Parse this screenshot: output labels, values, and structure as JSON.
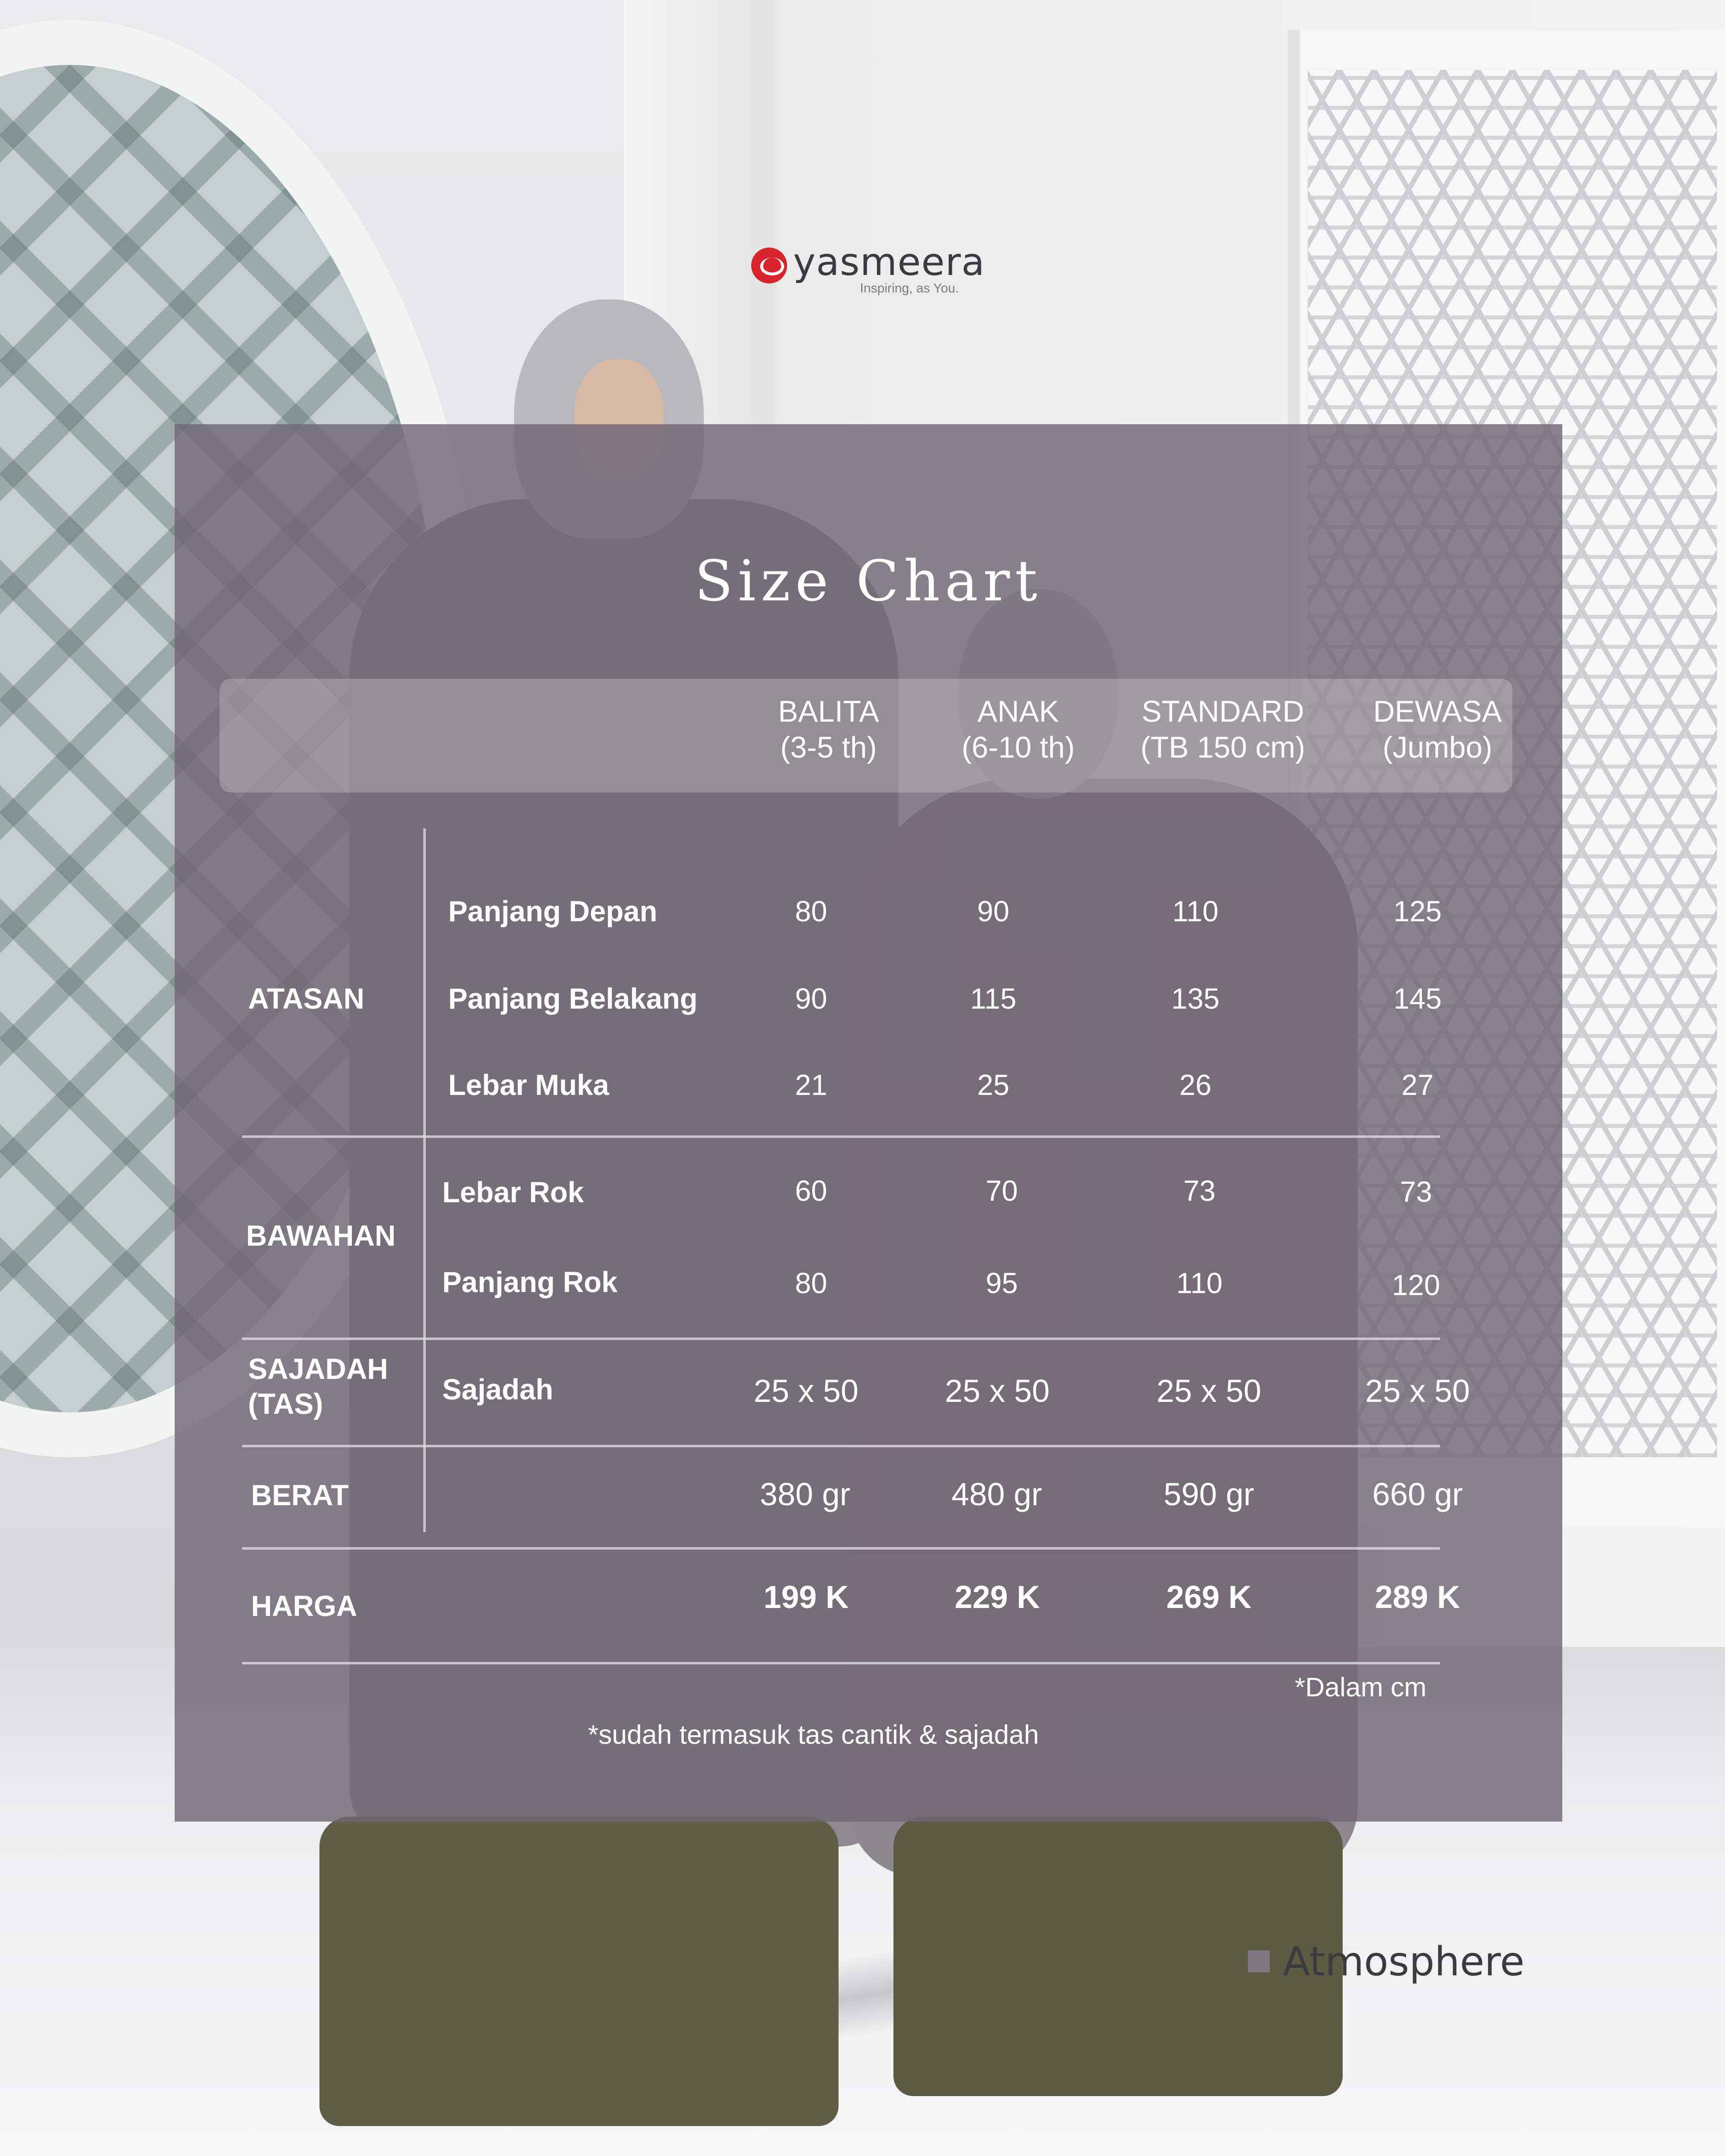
{
  "brand": {
    "name": "yasmeera",
    "tagline": "Inspiring, as You."
  },
  "title": "Size Chart",
  "columns": [
    {
      "line1": "BALITA",
      "line2": "(3-5 th)"
    },
    {
      "line1": "ANAK",
      "line2": "(6-10 th)"
    },
    {
      "line1": "STANDARD",
      "line2": "(TB 150 cm)"
    },
    {
      "line1": "DEWASA",
      "line2": "(Jumbo)"
    }
  ],
  "groups": {
    "atasan": "ATASAN",
    "bawahan": "BAWAHAN",
    "sajadah_line1": "SAJADAH",
    "sajadah_line2": "(TAS)",
    "berat": "BERAT",
    "harga": "HARGA"
  },
  "rows": {
    "panjang_depan": {
      "label": "Panjang Depan",
      "values": [
        "80",
        "90",
        "110",
        "125"
      ]
    },
    "panjang_belakang": {
      "label": "Panjang Belakang",
      "values": [
        "90",
        "115",
        "135",
        "145"
      ]
    },
    "lebar_muka": {
      "label": "Lebar Muka",
      "values": [
        "21",
        "25",
        "26",
        "27"
      ]
    },
    "lebar_rok": {
      "label": "Lebar Rok",
      "values": [
        "60",
        "70",
        "73",
        "73"
      ]
    },
    "panjang_rok": {
      "label": "Panjang Rok",
      "values": [
        "80",
        "95",
        "110",
        "120"
      ]
    },
    "sajadah": {
      "label": "Sajadah",
      "values": [
        "25 x 50",
        "25 x 50",
        "25 x 50",
        "25 x 50"
      ]
    },
    "berat": {
      "values": [
        "380 gr",
        "480 gr",
        "590 gr",
        "660 gr"
      ]
    },
    "harga": {
      "values": [
        "199 K",
        "229 K",
        "269 K",
        "289 K"
      ]
    }
  },
  "notes": {
    "unit": "*Dalam cm",
    "included": "*sudah termasuk tas cantik & sajadah"
  },
  "collection": "Atmosphere",
  "colors": {
    "brand_red": "#d9232d",
    "panel": "#706773",
    "text": "#ffffff"
  }
}
